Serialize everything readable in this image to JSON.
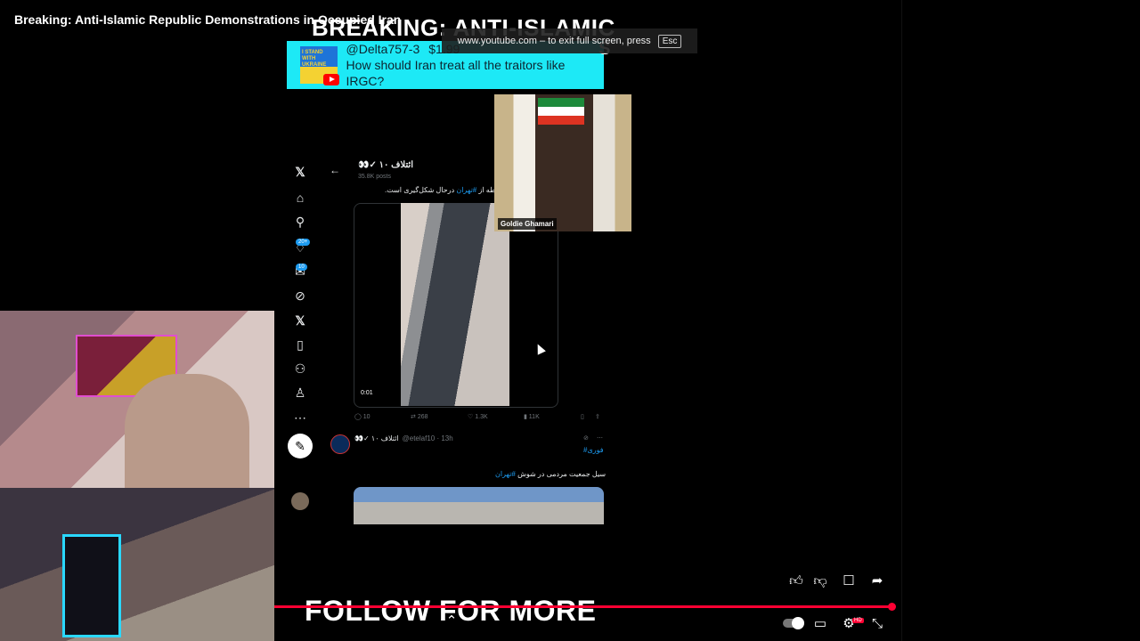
{
  "player": {
    "title": "Breaking: Anti-Islamic Republic Demonstrations in Occupied Iran",
    "overlay_heading": "BREAKING: ANTI-ISLAMIC",
    "overlay_heading_fragment": "S",
    "fullscreen_toast": "www.youtube.com – to exit full screen, press",
    "fullscreen_key": "Esc",
    "bottom_overlay": "FOLLOW FOR MORE",
    "progress_fraction": 0.995,
    "icons": [
      "like-icon",
      "dislike-icon",
      "comments-icon",
      "share-icon",
      "autoplay-toggle",
      "subtitles-icon",
      "settings-icon",
      "exit-fullscreen-icon",
      "chevron-up-icon"
    ],
    "settings_badge": "HD"
  },
  "superchat": {
    "name": "@Delta757-3",
    "amount": "$1.99",
    "message": "How should Iran treat all the traitors like IRGC?",
    "avatar_text": "I STAND WITH UKRAINE",
    "color": "#1de9f6"
  },
  "guest": {
    "name": "Goldie Ghamari"
  },
  "x_feed": {
    "nav_icons": [
      "x-logo-icon",
      "home-icon",
      "search-icon",
      "notifications-icon",
      "messages-icon",
      "grok-icon",
      "x-premium-icon",
      "bookmarks-icon",
      "communities-icon",
      "profile-icon",
      "more-icon"
    ],
    "notification_badge": "20+",
    "messages_badge": "10",
    "account_name": "👀✓ ائتلاف ۱۰",
    "account_posts": "35.8K posts",
    "tweet1": {
      "text_prefix": "نقطه از ",
      "hashtag": "#تهران",
      "text_suffix": " درحال شکل‌گیری است.",
      "video_time": "0:01",
      "replies": "10",
      "reposts": "268",
      "likes": "1.3K",
      "views": "11K"
    },
    "tweet2": {
      "name": "👀✓ ائتلاف ۱۰",
      "handle": "@etelaf10 · 13h",
      "hashtag": "#فوری",
      "text_prefix": "سیل جمعیت مردمی در شوش ",
      "text_hashtag": "#تهران"
    }
  }
}
